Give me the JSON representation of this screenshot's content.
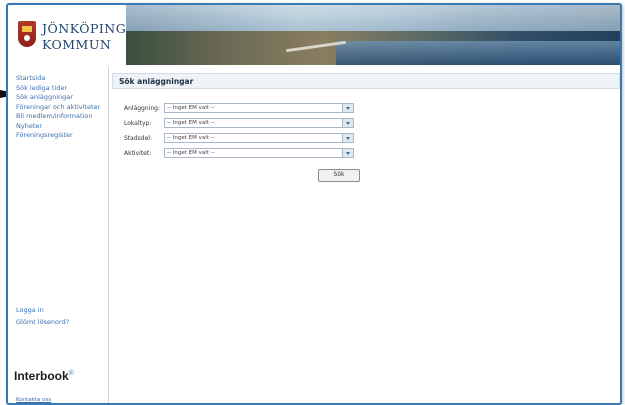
{
  "app": {
    "logo_line1": "JÖNKÖPINGS",
    "logo_line2": "KOMMUN"
  },
  "sidebar": {
    "nav": [
      {
        "label": "Startsida"
      },
      {
        "label": "Sök lediga tider"
      },
      {
        "label": "Sök anläggningar"
      },
      {
        "label": "Föreningar och aktiviteter"
      },
      {
        "label": "Bli medlem/information"
      },
      {
        "label": "Nyheter"
      },
      {
        "label": "Föreningsregister"
      }
    ],
    "login_label": "Logga in",
    "forgot_label": "Glömt lösenord?",
    "brand": "Interbook",
    "brand_sup": "®",
    "footer_label": "Kontakta oss"
  },
  "main": {
    "title": "Sök anläggningar",
    "fields": [
      {
        "label": "Anläggning:",
        "value": "-- Inget EM valt --"
      },
      {
        "label": "Lokaltyp:",
        "value": "-- Inget EM valt --"
      },
      {
        "label": "Stadsdel:",
        "value": "-- Inget EM valt --"
      },
      {
        "label": "Aktivitet:",
        "value": "-- Inget EM valt --"
      }
    ],
    "search_button": "Sök"
  },
  "colors": {
    "accent": "#3a79b3",
    "link": "#3b6fb0",
    "title_bg": "#eef3f8"
  }
}
